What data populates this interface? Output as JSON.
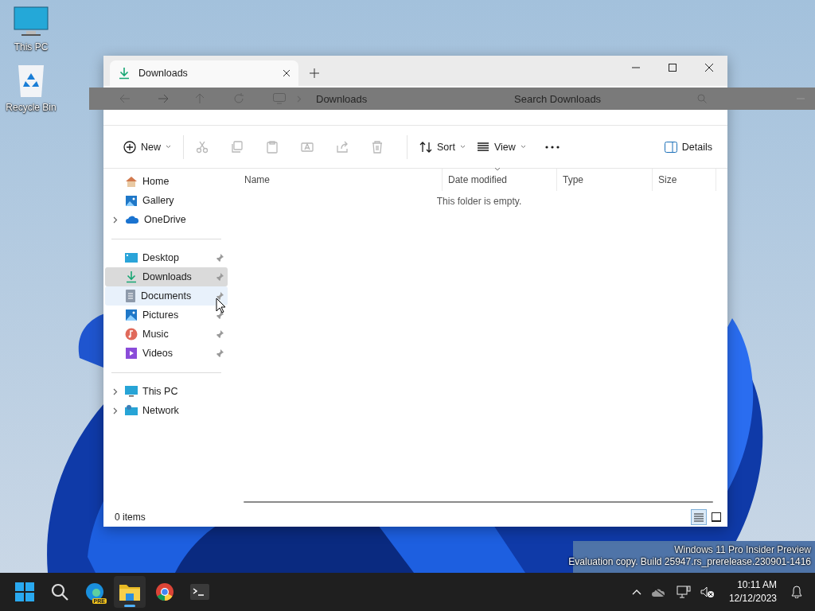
{
  "desktop_icons": [
    {
      "label": "This PC"
    },
    {
      "label": "Recycle Bin"
    }
  ],
  "window": {
    "tabs": [
      {
        "label": "Downloads",
        "selected": true
      }
    ],
    "address_bar": {
      "breadcrumb": "Downloads",
      "search": {
        "placeholder": "Search Downloads"
      }
    },
    "toolbar": [
      {
        "kind": "menu",
        "label": "New",
        "disabled": false
      },
      {
        "kind": "icon",
        "disabled": true
      },
      {
        "kind": "icon",
        "disabled": true
      },
      {
        "kind": "icon",
        "disabled": true
      },
      {
        "kind": "icon",
        "disabled": true
      },
      {
        "kind": "icon",
        "disabled": true
      },
      {
        "kind": "icon",
        "disabled": true
      },
      {
        "kind": "menu",
        "label": "Sort",
        "disabled": false
      },
      {
        "kind": "menu",
        "label": "View",
        "disabled": false
      },
      {
        "kind": "icon",
        "disabled": false
      }
    ],
    "details_button": {
      "label": "Details"
    },
    "sidebar": {
      "groups": [
        {
          "items": [
            {
              "label": "Home",
              "selected": false,
              "hovered": false,
              "pinned": false,
              "has_children": false
            },
            {
              "label": "Gallery",
              "selected": false,
              "hovered": false,
              "pinned": false,
              "has_children": false
            },
            {
              "label": "OneDrive",
              "selected": false,
              "hovered": false,
              "pinned": false,
              "has_children": true
            }
          ]
        },
        {
          "items": [
            {
              "label": "Desktop",
              "selected": false,
              "hovered": false,
              "pinned": true,
              "has_children": false
            },
            {
              "label": "Downloads",
              "selected": true,
              "hovered": false,
              "pinned": true,
              "has_children": false
            },
            {
              "label": "Documents",
              "selected": false,
              "hovered": true,
              "pinned": true,
              "has_children": false
            },
            {
              "label": "Pictures",
              "selected": false,
              "hovered": false,
              "pinned": true,
              "has_children": false
            },
            {
              "label": "Music",
              "selected": false,
              "hovered": false,
              "pinned": true,
              "has_children": false
            },
            {
              "label": "Videos",
              "selected": false,
              "hovered": false,
              "pinned": true,
              "has_children": false
            }
          ]
        },
        {
          "items": [
            {
              "label": "This PC",
              "selected": false,
              "hovered": false,
              "pinned": false,
              "has_children": true
            },
            {
              "label": "Network",
              "selected": false,
              "hovered": false,
              "pinned": false,
              "has_children": true
            }
          ]
        }
      ]
    },
    "table": {
      "columns": [
        {
          "label": "Name",
          "sorted": false
        },
        {
          "label": "Date modified",
          "sorted": true
        },
        {
          "label": "Type",
          "sorted": false
        },
        {
          "label": "Size",
          "sorted": false
        }
      ],
      "empty_message": "This folder is empty."
    },
    "status_bar": {
      "count": "0 items",
      "views": [
        {
          "selected": true
        },
        {
          "selected": false
        }
      ]
    }
  },
  "watermark": [
    "Windows 11 Pro Insider Preview",
    "Evaluation copy. Build 25947.rs_prerelease.230901-1416"
  ],
  "taskbar": {
    "apps": [
      {
        "selected": false
      },
      {
        "selected": false
      },
      {
        "selected": false,
        "badge": "PRE"
      },
      {
        "selected": true
      },
      {
        "selected": false
      },
      {
        "selected": false
      }
    ],
    "clock": {
      "time": "10:11 AM",
      "date": "12/12/2023"
    }
  }
}
